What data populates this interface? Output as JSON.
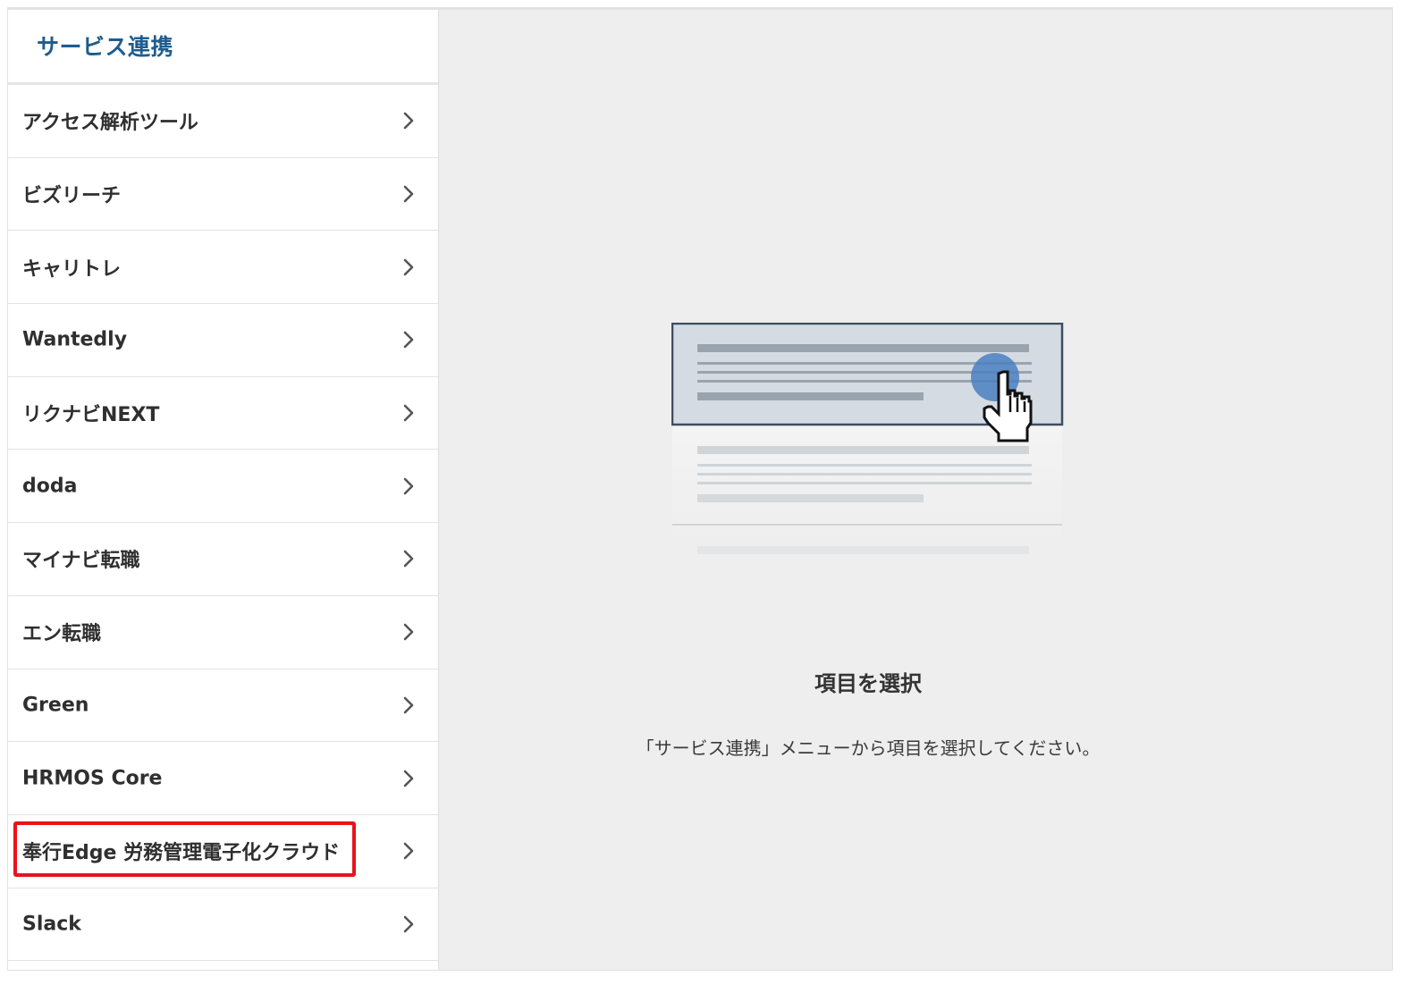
{
  "sidebar": {
    "title": "サービス連携",
    "items": [
      {
        "label": "アクセス解析ツール"
      },
      {
        "label": "ビズリーチ"
      },
      {
        "label": "キャリトレ"
      },
      {
        "label": "Wantedly"
      },
      {
        "label": "リクナビNEXT"
      },
      {
        "label": "doda"
      },
      {
        "label": "マイナビ転職"
      },
      {
        "label": "エン転職"
      },
      {
        "label": "Green"
      },
      {
        "label": "HRMOS Core"
      },
      {
        "label": "奉行Edge 労務管理電子化クラウド",
        "highlighted": true
      },
      {
        "label": "Slack"
      }
    ]
  },
  "main": {
    "empty_state_title": "項目を選択",
    "empty_state_description": "「サービス連携」メニューから項目を選択してください。"
  },
  "colors": {
    "title_accent": "#1f5c8d",
    "highlight_border": "#e8141b",
    "main_background": "#eeeeee",
    "cursor_circle": "#4a7fc1"
  },
  "icons": {
    "menu_item_arrow": "chevron-right-icon",
    "illustration": "list-select-pointer-illustration"
  }
}
